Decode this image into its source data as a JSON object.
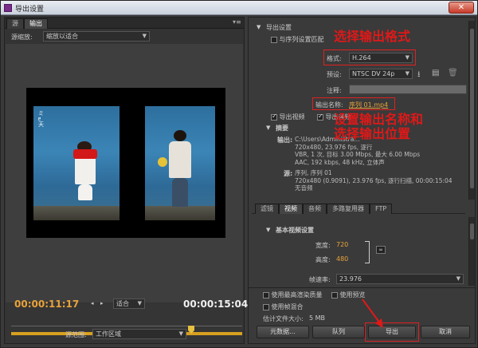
{
  "window": {
    "title": "导出设置",
    "close_label": "✕"
  },
  "source_panel": {
    "tabs": [
      "源",
      "输出"
    ],
    "active_tab": "输出",
    "scale_label": "源缩放:",
    "scale_value": "缩放以适合",
    "timecode_current": "00:00:11:17",
    "fit_value": "适合",
    "timecode_total": "00:00:15:04",
    "source_range_label": "源范围:",
    "source_range_value": "工作区域",
    "overlay_title": "ミ\nᥱ\n天"
  },
  "export_settings": {
    "section_title": "导出设置",
    "match_sequence_label": "与序列设置匹配",
    "format_label": "格式:",
    "format_value": "H.264",
    "preset_label": "预设:",
    "preset_value": "NTSC DV 24p",
    "comments_label": "注释:",
    "output_name_label": "输出名称:",
    "output_name_value": "序列 01.mp4",
    "export_video_label": "导出视频",
    "export_audio_label": "导出音频",
    "summary_title": "摘要",
    "summary_output_label": "输出:",
    "summary_output_lines": [
      "C:\\Users\\Administra...",
      "720x480, 23.976 fps, 逐行",
      "VBR, 1 次, 目标 3.00 Mbps, 最大 6.00 Mbps",
      "AAC, 192 kbps, 48 kHz, 立体声"
    ],
    "summary_source_label": "源:",
    "summary_source_lines": [
      "序列, 序列 01",
      "720x480 (0.9091), 23.976 fps, 逐行扫描, 00:00:15:04",
      "无音频"
    ]
  },
  "lower_tabs": [
    "滤镜",
    "视频",
    "音频",
    "多路复用器",
    "FTP"
  ],
  "lower_active_tab": "视频",
  "video_settings": {
    "section_title": "基本视频设置",
    "width_label": "宽度:",
    "width_value": "720",
    "height_label": "高度:",
    "height_value": "480",
    "framerate_label": "帧速率:",
    "framerate_value": "23.976"
  },
  "bottom_options": {
    "max_render_label": "使用最高渲染质量",
    "use_preview_label": "使用预览",
    "frame_blend_label": "使用帧混合",
    "file_size_label": "估计文件大小:",
    "file_size_value": "5 MB"
  },
  "buttons": {
    "metadata": "元数据...",
    "queue": "队列",
    "export": "导出",
    "cancel": "取消"
  },
  "annotations": {
    "select_format": "选择输出格式",
    "set_output": "设置输出名称和\n选择输出位置"
  },
  "colors": {
    "annotation_red": "#e01818",
    "timecode_orange": "#e8a33a",
    "track_yellow": "#d8a020"
  }
}
